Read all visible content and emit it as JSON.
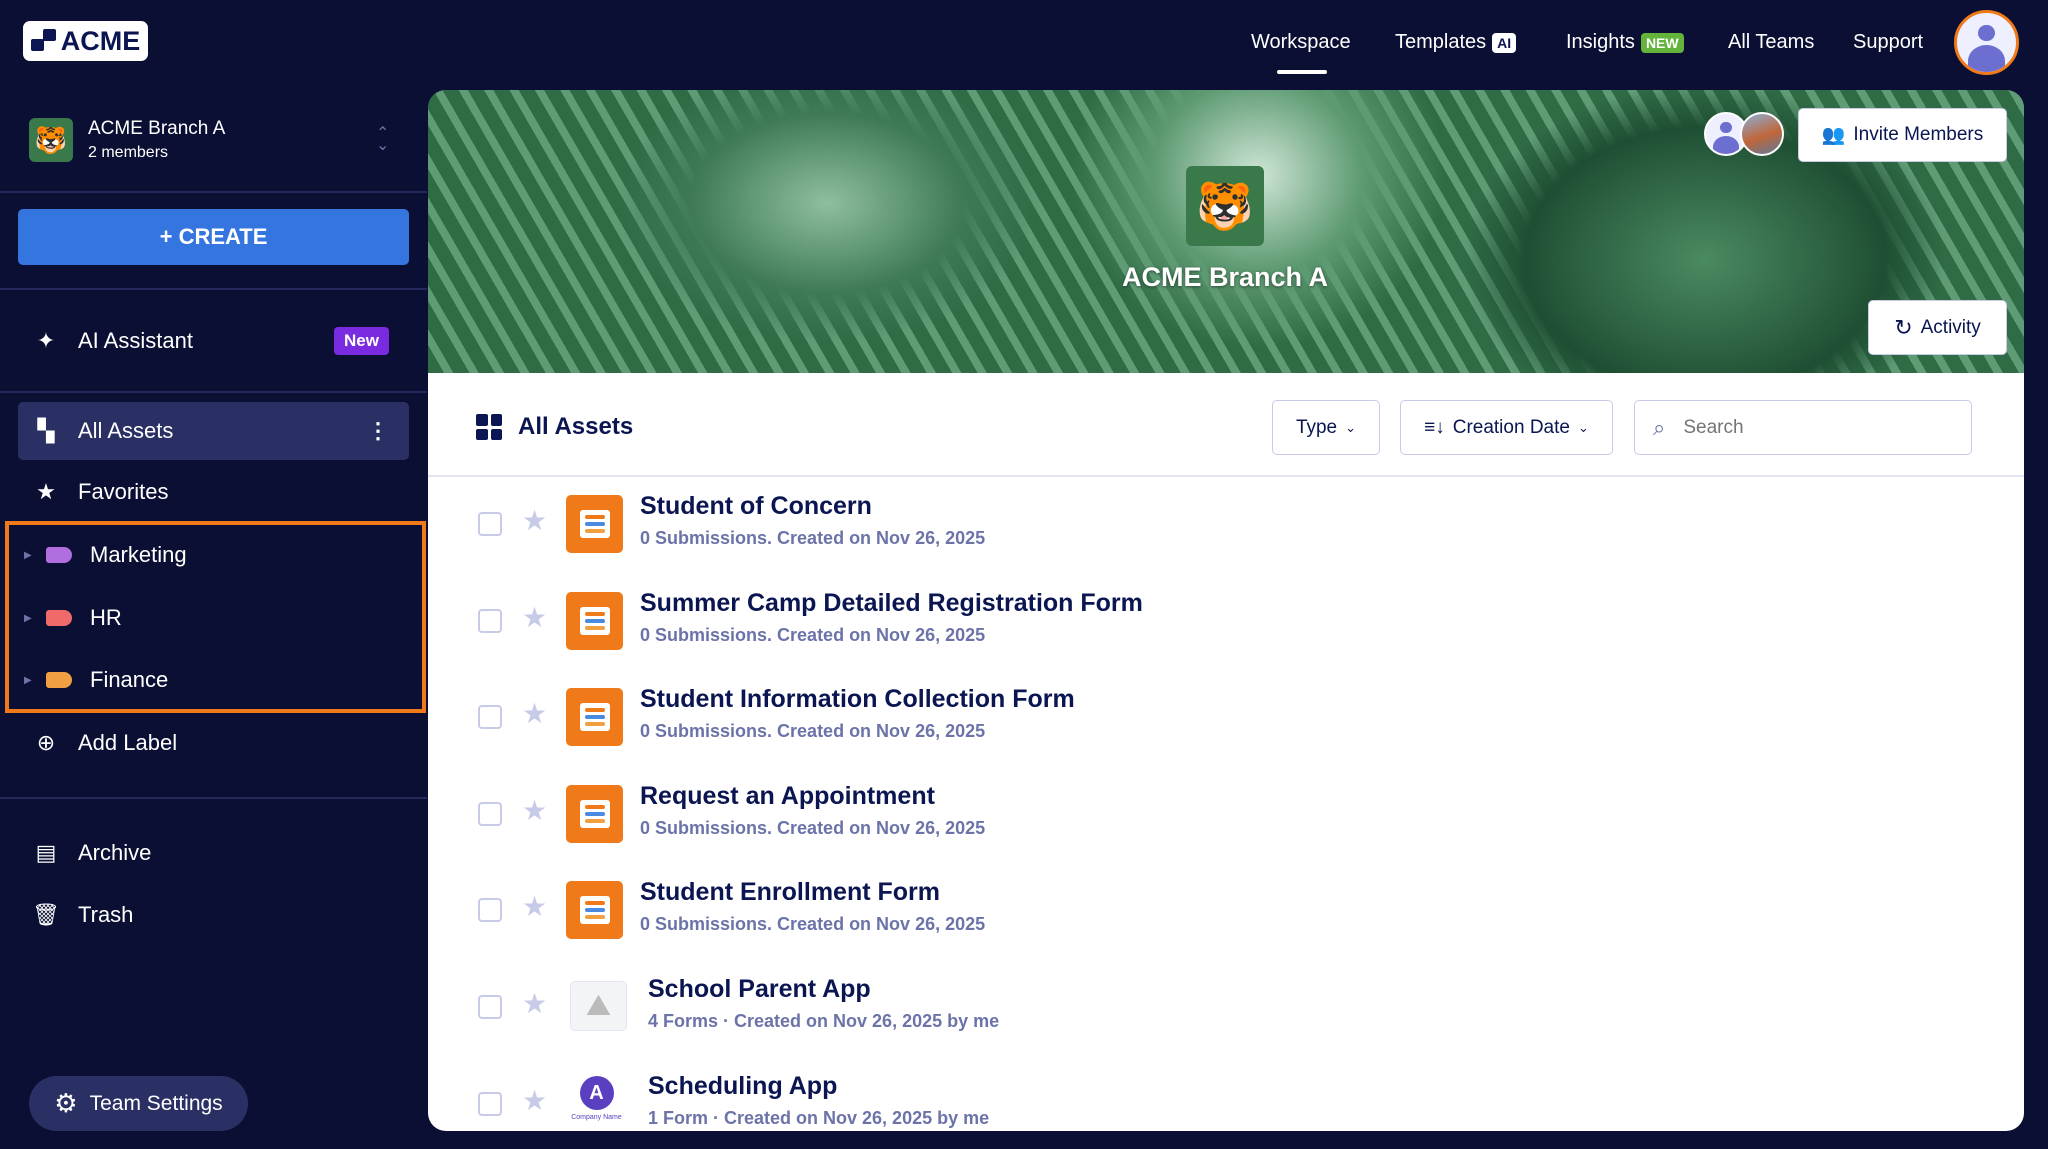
{
  "logo": "ACME",
  "team": {
    "name": "ACME Branch A",
    "members": "2 members"
  },
  "sidebar": {
    "create": "+ CREATE",
    "ai_assistant": "AI Assistant",
    "ai_badge": "New",
    "all_assets": "All Assets",
    "favorites": "Favorites",
    "labels": [
      {
        "name": "Marketing",
        "color": "#b06ee0"
      },
      {
        "name": "HR",
        "color": "#f06a6a"
      },
      {
        "name": "Finance",
        "color": "#f0a040"
      }
    ],
    "add_label": "Add Label",
    "archive": "Archive",
    "trash": "Trash",
    "team_settings": "Team Settings"
  },
  "topnav": {
    "workspace": "Workspace",
    "templates": "Templates",
    "templates_badge": "AI",
    "insights": "Insights",
    "insights_badge": "NEW",
    "all_teams": "All Teams",
    "support": "Support"
  },
  "banner": {
    "title": "ACME Branch A",
    "invite": "Invite Members",
    "activity": "Activity"
  },
  "assets": {
    "title": "All Assets",
    "type": "Type",
    "sort": "Creation Date",
    "search_placeholder": "Search",
    "items": [
      {
        "title": "Student of Concern",
        "sub": "0 Submissions. Created on Nov 26, 2025",
        "kind": "form"
      },
      {
        "title": "Summer Camp Detailed Registration Form",
        "sub": "0 Submissions. Created on Nov 26, 2025",
        "kind": "form"
      },
      {
        "title": "Student Information Collection Form",
        "sub": "0 Submissions. Created on Nov 26, 2025",
        "kind": "form"
      },
      {
        "title": "Request an Appointment",
        "sub": "0 Submissions. Created on Nov 26, 2025",
        "kind": "form"
      },
      {
        "title": "Student Enrollment Form",
        "sub": "0 Submissions. Created on Nov 26, 2025",
        "kind": "form"
      },
      {
        "title": "School Parent App",
        "sub": "4 Forms · Created on Nov 26, 2025 by me",
        "kind": "app-image"
      },
      {
        "title": "Scheduling App",
        "sub": "1 Form · Created on Nov 26, 2025 by me",
        "kind": "app-logo",
        "logo_caption": "Company Name"
      }
    ]
  }
}
